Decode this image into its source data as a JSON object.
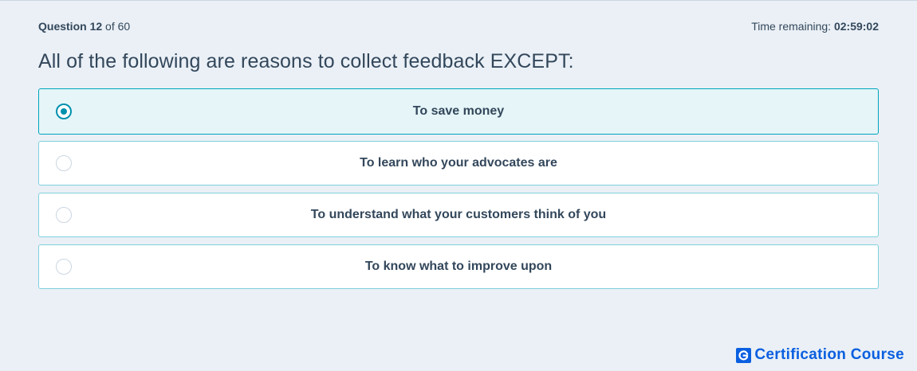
{
  "header": {
    "question_label": "Question",
    "question_number": "12",
    "question_of": "of",
    "question_total": "60",
    "time_label": "Time remaining:",
    "time_value": "02:59:02"
  },
  "question": {
    "text": "All of the following are reasons to collect feedback EXCEPT:"
  },
  "options": [
    {
      "label": "To save money",
      "selected": true
    },
    {
      "label": "To learn who your advocates are",
      "selected": false
    },
    {
      "label": "To understand what your customers think of you",
      "selected": false
    },
    {
      "label": "To know what to improve upon",
      "selected": false
    }
  ],
  "brand": {
    "text": "Certification Course",
    "icon": "g-logo-icon",
    "color": "#0a5fe0"
  },
  "colors": {
    "background": "#eaf0f6",
    "text": "#33475b",
    "accent": "#0091ae",
    "selected_bg": "#e5f5f8",
    "option_border": "#7fd1de"
  }
}
